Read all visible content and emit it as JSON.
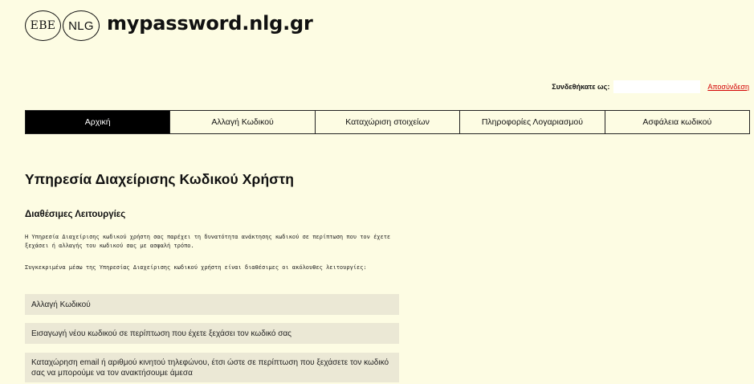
{
  "header": {
    "logo_ebe": "EBE",
    "logo_nlg": "NLG",
    "site_title": "mypassword.nlg.gr"
  },
  "login": {
    "label": "Συνδεθήκατε ως:",
    "username": "",
    "logout": "Αποσύνδεση"
  },
  "nav": {
    "items": [
      {
        "label": "Αρχική",
        "active": true
      },
      {
        "label": "Αλλαγή Κωδικού",
        "active": false
      },
      {
        "label": "Καταχώριση στοιχείων",
        "active": false
      },
      {
        "label": "Πληροφορίες Λογαριασμού",
        "active": false
      },
      {
        "label": "Ασφάλεια κωδικού",
        "active": false
      }
    ]
  },
  "main": {
    "title": "Υπηρεσία Διαχείρισης Κωδικού Χρήστη",
    "section_heading": "Διαθέσιμες Λειτουργίες",
    "paragraph1": "Η Υπηρεσία Διαχείρισης κωδικού χρήστη σας παρέχει τη δυνατότητα ανάκτησης κωδικού σε περίπτωση που τον έχετε ξεχάσει ή αλλαγής του κωδικού σας με ασφαλή τρόπο.",
    "paragraph2": "Συγκεκριμένα μέσω της Υπηρεσίας Διαχείρισης κωδικού χρήστη είναι διαθέσιμες οι ακόλουθες λειτουργίες:",
    "features": [
      "Αλλαγή Κωδικού",
      "Εισαγωγή νέου κωδικού σε περίπτωση που έχετε ξεχάσει τον κωδικό σας",
      "Καταχώρηση email ή αριθμού κινητού τηλεφώνου, έτσι ώστε σε περίπτωση που ξεχάσετε τον κωδικό σας να μπορούμε να τον ανακτήσουμε άμεσα"
    ]
  },
  "colors": {
    "background": "#fdfce3",
    "nav_active_bg": "#000000",
    "feature_bg": "#ebe8d5",
    "logout_link": "#d30000"
  }
}
